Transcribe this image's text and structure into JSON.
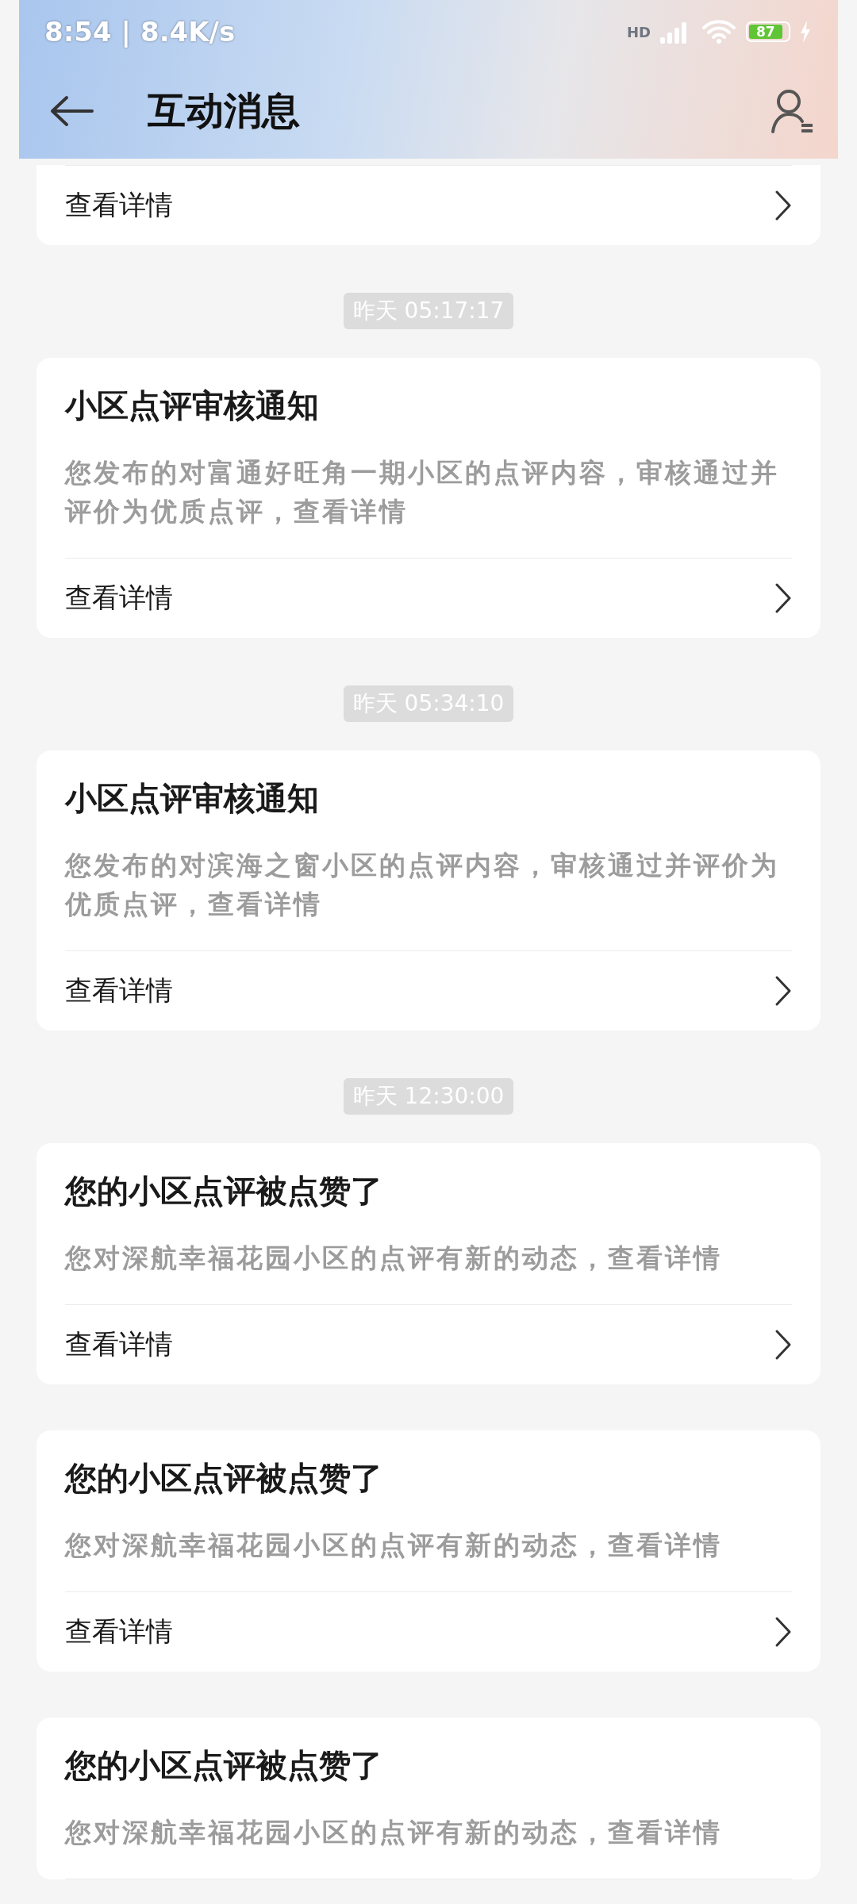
{
  "status_bar": {
    "time": "8:54",
    "separator": "|",
    "speed": "8.4K/s",
    "network": "HD",
    "battery": "87"
  },
  "header": {
    "title": "互动消息"
  },
  "messages": [
    {
      "link": "查看详情"
    },
    {
      "timestamp": "昨天 05:17:17",
      "title": "小区点评审核通知",
      "body": "您发布的对富通好旺角一期小区的点评内容，审核通过并评价为优质点评，查看详情",
      "link": "查看详情"
    },
    {
      "timestamp": "昨天 05:34:10",
      "title": "小区点评审核通知",
      "body": "您发布的对滨海之窗小区的点评内容，审核通过并评价为优质点评，查看详情",
      "link": "查看详情"
    },
    {
      "timestamp": "昨天 12:30:00",
      "title": "您的小区点评被点赞了",
      "body": "您对深航幸福花园小区的点评有新的动态，查看详情",
      "link": "查看详情"
    },
    {
      "title": "您的小区点评被点赞了",
      "body": "您对深航幸福花园小区的点评有新的动态，查看详情",
      "link": "查看详情"
    },
    {
      "title": "您的小区点评被点赞了",
      "body": "您对深航幸福花园小区的点评有新的动态，查看详情"
    }
  ]
}
